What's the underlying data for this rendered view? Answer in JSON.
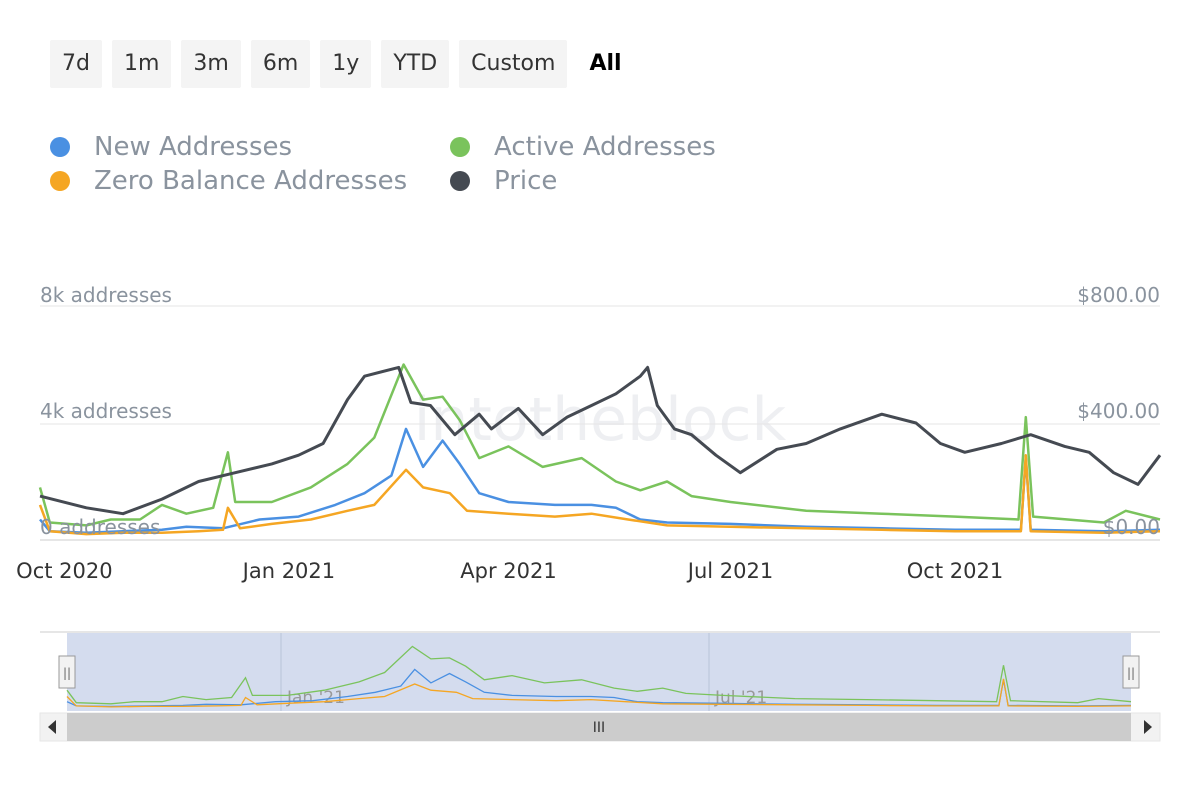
{
  "range_buttons": [
    {
      "label": "7d",
      "active": false
    },
    {
      "label": "1m",
      "active": false
    },
    {
      "label": "3m",
      "active": false
    },
    {
      "label": "6m",
      "active": false
    },
    {
      "label": "1y",
      "active": false
    },
    {
      "label": "YTD",
      "active": false
    },
    {
      "label": "Custom",
      "active": false
    },
    {
      "label": "All",
      "active": true
    }
  ],
  "watermark": "intotheblock",
  "navigator": {
    "labels": [
      "Jan '21",
      "Jul '21"
    ],
    "scroll_grip": "III",
    "handle_grip": "||"
  },
  "chart_data": {
    "type": "line",
    "y_axis_left": {
      "ticks": [
        "0 addresses",
        "4k addresses",
        "8k addresses"
      ],
      "range": [
        0,
        8000
      ]
    },
    "y_axis_right": {
      "ticks": [
        "$0.00",
        "$400.00",
        "$800.00"
      ],
      "range": [
        0,
        800
      ]
    },
    "x_labels": [
      "Oct 2020",
      "Jan 2021",
      "Apr 2021",
      "Jul 2021",
      "Oct 2021"
    ],
    "x_label_dates": [
      "2020-10-01",
      "2021-01-01",
      "2021-04-01",
      "2021-07-01",
      "2021-10-01"
    ],
    "x_range": [
      "2020-09-21",
      "2021-12-24"
    ],
    "grid": true,
    "legend_position": "top-left",
    "series": [
      {
        "name": "New Addresses",
        "color": "#4a90e2",
        "axis": "left",
        "points": [
          [
            "2020-09-21",
            700
          ],
          [
            "2020-09-25",
            300
          ],
          [
            "2020-10-10",
            250
          ],
          [
            "2020-10-25",
            300
          ],
          [
            "2020-11-10",
            350
          ],
          [
            "2020-11-20",
            450
          ],
          [
            "2020-12-05",
            400
          ],
          [
            "2020-12-20",
            700
          ],
          [
            "2021-01-05",
            800
          ],
          [
            "2021-01-20",
            1200
          ],
          [
            "2021-02-01",
            1600
          ],
          [
            "2021-02-12",
            2200
          ],
          [
            "2021-02-18",
            3800
          ],
          [
            "2021-02-25",
            2500
          ],
          [
            "2021-03-05",
            3400
          ],
          [
            "2021-03-12",
            2600
          ],
          [
            "2021-03-20",
            1600
          ],
          [
            "2021-04-01",
            1300
          ],
          [
            "2021-04-20",
            1200
          ],
          [
            "2021-05-05",
            1200
          ],
          [
            "2021-05-15",
            1100
          ],
          [
            "2021-05-25",
            700
          ],
          [
            "2021-06-05",
            600
          ],
          [
            "2021-07-01",
            550
          ],
          [
            "2021-08-01",
            450
          ],
          [
            "2021-09-01",
            400
          ],
          [
            "2021-10-01",
            350
          ],
          [
            "2021-10-28",
            350
          ],
          [
            "2021-10-30",
            2800
          ],
          [
            "2021-11-01",
            350
          ],
          [
            "2021-12-01",
            300
          ],
          [
            "2021-12-24",
            350
          ]
        ]
      },
      {
        "name": "Active Addresses",
        "color": "#7ac35c",
        "axis": "left",
        "points": [
          [
            "2020-09-21",
            1800
          ],
          [
            "2020-09-25",
            600
          ],
          [
            "2020-10-10",
            500
          ],
          [
            "2020-10-20",
            700
          ],
          [
            "2020-11-01",
            700
          ],
          [
            "2020-11-10",
            1200
          ],
          [
            "2020-11-20",
            900
          ],
          [
            "2020-12-01",
            1100
          ],
          [
            "2020-12-07",
            3000
          ],
          [
            "2020-12-10",
            1300
          ],
          [
            "2020-12-25",
            1300
          ],
          [
            "2021-01-10",
            1800
          ],
          [
            "2021-01-25",
            2600
          ],
          [
            "2021-02-05",
            3500
          ],
          [
            "2021-02-17",
            6000
          ],
          [
            "2021-02-25",
            4800
          ],
          [
            "2021-03-05",
            4900
          ],
          [
            "2021-03-12",
            4100
          ],
          [
            "2021-03-20",
            2800
          ],
          [
            "2021-04-01",
            3200
          ],
          [
            "2021-04-15",
            2500
          ],
          [
            "2021-05-01",
            2800
          ],
          [
            "2021-05-15",
            2000
          ],
          [
            "2021-05-25",
            1700
          ],
          [
            "2021-06-05",
            2000
          ],
          [
            "2021-06-15",
            1500
          ],
          [
            "2021-07-01",
            1300
          ],
          [
            "2021-08-01",
            1000
          ],
          [
            "2021-09-01",
            900
          ],
          [
            "2021-10-01",
            800
          ],
          [
            "2021-10-27",
            700
          ],
          [
            "2021-10-30",
            4200
          ],
          [
            "2021-11-02",
            800
          ],
          [
            "2021-12-01",
            600
          ],
          [
            "2021-12-10",
            1000
          ],
          [
            "2021-12-24",
            700
          ]
        ]
      },
      {
        "name": "Zero Balance Addresses",
        "color": "#f5a623",
        "axis": "left",
        "points": [
          [
            "2020-09-21",
            1200
          ],
          [
            "2020-09-25",
            300
          ],
          [
            "2020-10-10",
            200
          ],
          [
            "2020-10-25",
            250
          ],
          [
            "2020-11-10",
            250
          ],
          [
            "2020-11-25",
            300
          ],
          [
            "2020-12-05",
            350
          ],
          [
            "2020-12-07",
            1100
          ],
          [
            "2020-12-12",
            400
          ],
          [
            "2020-12-25",
            550
          ],
          [
            "2021-01-10",
            700
          ],
          [
            "2021-01-25",
            1000
          ],
          [
            "2021-02-05",
            1200
          ],
          [
            "2021-02-18",
            2400
          ],
          [
            "2021-02-25",
            1800
          ],
          [
            "2021-03-08",
            1600
          ],
          [
            "2021-03-15",
            1000
          ],
          [
            "2021-04-01",
            900
          ],
          [
            "2021-04-20",
            800
          ],
          [
            "2021-05-05",
            900
          ],
          [
            "2021-05-20",
            700
          ],
          [
            "2021-06-05",
            500
          ],
          [
            "2021-07-01",
            450
          ],
          [
            "2021-08-01",
            400
          ],
          [
            "2021-09-01",
            350
          ],
          [
            "2021-10-01",
            300
          ],
          [
            "2021-10-28",
            300
          ],
          [
            "2021-10-30",
            2900
          ],
          [
            "2021-11-01",
            300
          ],
          [
            "2021-12-01",
            250
          ],
          [
            "2021-12-24",
            300
          ]
        ]
      },
      {
        "name": "Price",
        "color": "#454a52",
        "axis": "right",
        "points": [
          [
            "2020-09-21",
            150
          ],
          [
            "2020-10-10",
            110
          ],
          [
            "2020-10-25",
            90
          ],
          [
            "2020-11-10",
            140
          ],
          [
            "2020-11-25",
            200
          ],
          [
            "2020-12-10",
            230
          ],
          [
            "2020-12-25",
            260
          ],
          [
            "2021-01-05",
            290
          ],
          [
            "2021-01-15",
            330
          ],
          [
            "2021-01-25",
            480
          ],
          [
            "2021-02-01",
            560
          ],
          [
            "2021-02-15",
            590
          ],
          [
            "2021-02-20",
            470
          ],
          [
            "2021-02-28",
            460
          ],
          [
            "2021-03-10",
            360
          ],
          [
            "2021-03-20",
            430
          ],
          [
            "2021-03-25",
            380
          ],
          [
            "2021-04-05",
            450
          ],
          [
            "2021-04-15",
            360
          ],
          [
            "2021-04-25",
            420
          ],
          [
            "2021-05-05",
            460
          ],
          [
            "2021-05-15",
            500
          ],
          [
            "2021-05-25",
            560
          ],
          [
            "2021-05-28",
            590
          ],
          [
            "2021-06-01",
            460
          ],
          [
            "2021-06-08",
            380
          ],
          [
            "2021-06-15",
            360
          ],
          [
            "2021-06-25",
            290
          ],
          [
            "2021-07-05",
            230
          ],
          [
            "2021-07-20",
            310
          ],
          [
            "2021-08-01",
            330
          ],
          [
            "2021-08-15",
            380
          ],
          [
            "2021-09-01",
            430
          ],
          [
            "2021-09-15",
            400
          ],
          [
            "2021-09-25",
            330
          ],
          [
            "2021-10-05",
            300
          ],
          [
            "2021-10-20",
            330
          ],
          [
            "2021-11-01",
            360
          ],
          [
            "2021-11-15",
            320
          ],
          [
            "2021-11-25",
            300
          ],
          [
            "2021-12-05",
            230
          ],
          [
            "2021-12-15",
            190
          ],
          [
            "2021-12-24",
            290
          ]
        ]
      }
    ]
  }
}
